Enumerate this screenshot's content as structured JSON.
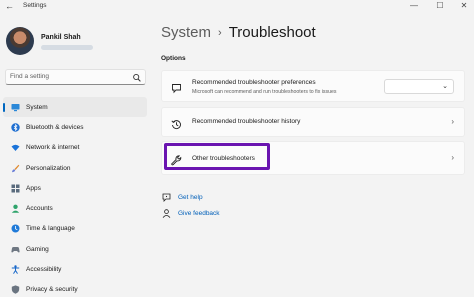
{
  "titlebar": {
    "back_label": "←",
    "app_title": "Settings",
    "minimize": "—",
    "maximize": "☐",
    "close": "✕"
  },
  "profile": {
    "name": "Pankil Shah"
  },
  "search": {
    "placeholder": "Find a setting"
  },
  "sidebar": {
    "items": [
      {
        "label": "System",
        "icon": "monitor-icon",
        "active": true
      },
      {
        "label": "Bluetooth & devices",
        "icon": "bluetooth-icon"
      },
      {
        "label": "Network & internet",
        "icon": "wifi-icon"
      },
      {
        "label": "Personalization",
        "icon": "paintbrush-icon"
      },
      {
        "label": "Apps",
        "icon": "apps-icon"
      },
      {
        "label": "Accounts",
        "icon": "person-icon"
      },
      {
        "label": "Time & language",
        "icon": "globe-clock-icon"
      },
      {
        "label": "Gaming",
        "icon": "gamepad-icon"
      },
      {
        "label": "Accessibility",
        "icon": "accessibility-icon"
      },
      {
        "label": "Privacy & security",
        "icon": "shield-icon"
      }
    ]
  },
  "breadcrumb": {
    "parent": "System",
    "separator": "›",
    "current": "Troubleshoot"
  },
  "main": {
    "section_label": "Options",
    "cards": {
      "preferences": {
        "title": "Recommended troubleshooter preferences",
        "subtitle": "Microsoft can recommend and run troubleshooters to fix issues",
        "dropdown_value": "",
        "icon": "chat-bubble-icon"
      },
      "history": {
        "title": "Recommended troubleshooter history",
        "icon": "history-icon",
        "chevron": "›"
      },
      "other": {
        "title": "Other troubleshooters",
        "icon": "wrench-icon",
        "chevron": "›"
      }
    },
    "links": {
      "help": "Get help",
      "feedback": "Give feedback"
    }
  },
  "colors": {
    "accent": "#0067c0",
    "link": "#005fb8",
    "highlight": "#6a14b0"
  }
}
